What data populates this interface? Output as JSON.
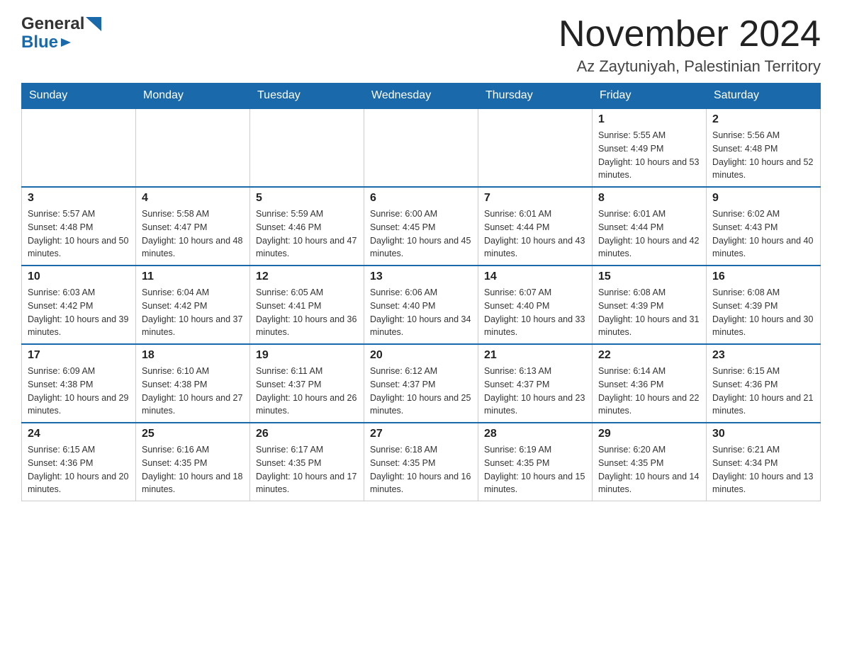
{
  "header": {
    "month_year": "November 2024",
    "location": "Az Zaytuniyah, Palestinian Territory",
    "logo_general": "General",
    "logo_blue": "Blue"
  },
  "days_of_week": [
    "Sunday",
    "Monday",
    "Tuesday",
    "Wednesday",
    "Thursday",
    "Friday",
    "Saturday"
  ],
  "weeks": [
    {
      "days": [
        {
          "number": "",
          "sunrise": "",
          "sunset": "",
          "daylight": "",
          "empty": true
        },
        {
          "number": "",
          "sunrise": "",
          "sunset": "",
          "daylight": "",
          "empty": true
        },
        {
          "number": "",
          "sunrise": "",
          "sunset": "",
          "daylight": "",
          "empty": true
        },
        {
          "number": "",
          "sunrise": "",
          "sunset": "",
          "daylight": "",
          "empty": true
        },
        {
          "number": "",
          "sunrise": "",
          "sunset": "",
          "daylight": "",
          "empty": true
        },
        {
          "number": "1",
          "sunrise": "Sunrise: 5:55 AM",
          "sunset": "Sunset: 4:49 PM",
          "daylight": "Daylight: 10 hours and 53 minutes.",
          "empty": false
        },
        {
          "number": "2",
          "sunrise": "Sunrise: 5:56 AM",
          "sunset": "Sunset: 4:48 PM",
          "daylight": "Daylight: 10 hours and 52 minutes.",
          "empty": false
        }
      ]
    },
    {
      "days": [
        {
          "number": "3",
          "sunrise": "Sunrise: 5:57 AM",
          "sunset": "Sunset: 4:48 PM",
          "daylight": "Daylight: 10 hours and 50 minutes.",
          "empty": false
        },
        {
          "number": "4",
          "sunrise": "Sunrise: 5:58 AM",
          "sunset": "Sunset: 4:47 PM",
          "daylight": "Daylight: 10 hours and 48 minutes.",
          "empty": false
        },
        {
          "number": "5",
          "sunrise": "Sunrise: 5:59 AM",
          "sunset": "Sunset: 4:46 PM",
          "daylight": "Daylight: 10 hours and 47 minutes.",
          "empty": false
        },
        {
          "number": "6",
          "sunrise": "Sunrise: 6:00 AM",
          "sunset": "Sunset: 4:45 PM",
          "daylight": "Daylight: 10 hours and 45 minutes.",
          "empty": false
        },
        {
          "number": "7",
          "sunrise": "Sunrise: 6:01 AM",
          "sunset": "Sunset: 4:44 PM",
          "daylight": "Daylight: 10 hours and 43 minutes.",
          "empty": false
        },
        {
          "number": "8",
          "sunrise": "Sunrise: 6:01 AM",
          "sunset": "Sunset: 4:44 PM",
          "daylight": "Daylight: 10 hours and 42 minutes.",
          "empty": false
        },
        {
          "number": "9",
          "sunrise": "Sunrise: 6:02 AM",
          "sunset": "Sunset: 4:43 PM",
          "daylight": "Daylight: 10 hours and 40 minutes.",
          "empty": false
        }
      ]
    },
    {
      "days": [
        {
          "number": "10",
          "sunrise": "Sunrise: 6:03 AM",
          "sunset": "Sunset: 4:42 PM",
          "daylight": "Daylight: 10 hours and 39 minutes.",
          "empty": false
        },
        {
          "number": "11",
          "sunrise": "Sunrise: 6:04 AM",
          "sunset": "Sunset: 4:42 PM",
          "daylight": "Daylight: 10 hours and 37 minutes.",
          "empty": false
        },
        {
          "number": "12",
          "sunrise": "Sunrise: 6:05 AM",
          "sunset": "Sunset: 4:41 PM",
          "daylight": "Daylight: 10 hours and 36 minutes.",
          "empty": false
        },
        {
          "number": "13",
          "sunrise": "Sunrise: 6:06 AM",
          "sunset": "Sunset: 4:40 PM",
          "daylight": "Daylight: 10 hours and 34 minutes.",
          "empty": false
        },
        {
          "number": "14",
          "sunrise": "Sunrise: 6:07 AM",
          "sunset": "Sunset: 4:40 PM",
          "daylight": "Daylight: 10 hours and 33 minutes.",
          "empty": false
        },
        {
          "number": "15",
          "sunrise": "Sunrise: 6:08 AM",
          "sunset": "Sunset: 4:39 PM",
          "daylight": "Daylight: 10 hours and 31 minutes.",
          "empty": false
        },
        {
          "number": "16",
          "sunrise": "Sunrise: 6:08 AM",
          "sunset": "Sunset: 4:39 PM",
          "daylight": "Daylight: 10 hours and 30 minutes.",
          "empty": false
        }
      ]
    },
    {
      "days": [
        {
          "number": "17",
          "sunrise": "Sunrise: 6:09 AM",
          "sunset": "Sunset: 4:38 PM",
          "daylight": "Daylight: 10 hours and 29 minutes.",
          "empty": false
        },
        {
          "number": "18",
          "sunrise": "Sunrise: 6:10 AM",
          "sunset": "Sunset: 4:38 PM",
          "daylight": "Daylight: 10 hours and 27 minutes.",
          "empty": false
        },
        {
          "number": "19",
          "sunrise": "Sunrise: 6:11 AM",
          "sunset": "Sunset: 4:37 PM",
          "daylight": "Daylight: 10 hours and 26 minutes.",
          "empty": false
        },
        {
          "number": "20",
          "sunrise": "Sunrise: 6:12 AM",
          "sunset": "Sunset: 4:37 PM",
          "daylight": "Daylight: 10 hours and 25 minutes.",
          "empty": false
        },
        {
          "number": "21",
          "sunrise": "Sunrise: 6:13 AM",
          "sunset": "Sunset: 4:37 PM",
          "daylight": "Daylight: 10 hours and 23 minutes.",
          "empty": false
        },
        {
          "number": "22",
          "sunrise": "Sunrise: 6:14 AM",
          "sunset": "Sunset: 4:36 PM",
          "daylight": "Daylight: 10 hours and 22 minutes.",
          "empty": false
        },
        {
          "number": "23",
          "sunrise": "Sunrise: 6:15 AM",
          "sunset": "Sunset: 4:36 PM",
          "daylight": "Daylight: 10 hours and 21 minutes.",
          "empty": false
        }
      ]
    },
    {
      "days": [
        {
          "number": "24",
          "sunrise": "Sunrise: 6:15 AM",
          "sunset": "Sunset: 4:36 PM",
          "daylight": "Daylight: 10 hours and 20 minutes.",
          "empty": false
        },
        {
          "number": "25",
          "sunrise": "Sunrise: 6:16 AM",
          "sunset": "Sunset: 4:35 PM",
          "daylight": "Daylight: 10 hours and 18 minutes.",
          "empty": false
        },
        {
          "number": "26",
          "sunrise": "Sunrise: 6:17 AM",
          "sunset": "Sunset: 4:35 PM",
          "daylight": "Daylight: 10 hours and 17 minutes.",
          "empty": false
        },
        {
          "number": "27",
          "sunrise": "Sunrise: 6:18 AM",
          "sunset": "Sunset: 4:35 PM",
          "daylight": "Daylight: 10 hours and 16 minutes.",
          "empty": false
        },
        {
          "number": "28",
          "sunrise": "Sunrise: 6:19 AM",
          "sunset": "Sunset: 4:35 PM",
          "daylight": "Daylight: 10 hours and 15 minutes.",
          "empty": false
        },
        {
          "number": "29",
          "sunrise": "Sunrise: 6:20 AM",
          "sunset": "Sunset: 4:35 PM",
          "daylight": "Daylight: 10 hours and 14 minutes.",
          "empty": false
        },
        {
          "number": "30",
          "sunrise": "Sunrise: 6:21 AM",
          "sunset": "Sunset: 4:34 PM",
          "daylight": "Daylight: 10 hours and 13 minutes.",
          "empty": false
        }
      ]
    }
  ]
}
